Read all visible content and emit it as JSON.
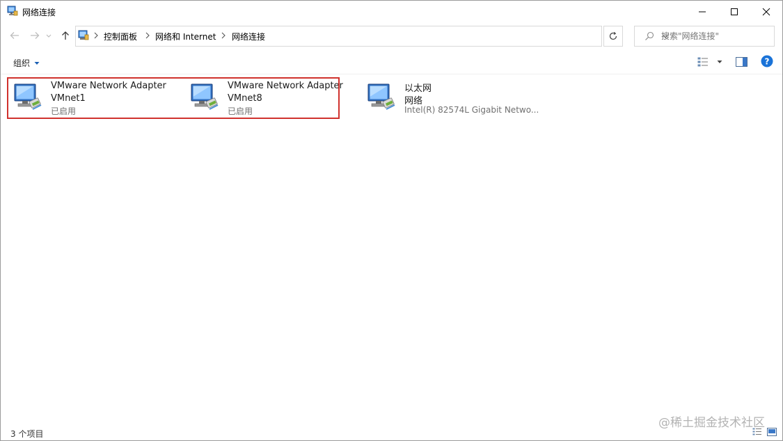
{
  "window": {
    "title": "网络连接",
    "app_icon": "network-connections-icon",
    "controls": [
      "minimize-icon",
      "maximize-icon",
      "close-icon"
    ]
  },
  "address_bar": {
    "location_icon": "control-panel-icon",
    "breadcrumbs": [
      "控制面板",
      "网络和 Internet",
      "网络连接"
    ],
    "search_placeholder": "搜索\"网络连接\""
  },
  "toolbar": {
    "organize_label": "组织",
    "view_options_icon": "change-view-icon",
    "preview_pane_icon": "preview-pane-icon",
    "help_icon": "help-icon"
  },
  "items": [
    {
      "name": "VMware Network Adapter",
      "sub": "VMnet1",
      "status": "已启用",
      "icon": "network-adapter-icon"
    },
    {
      "name": "VMware Network Adapter",
      "sub": "VMnet8",
      "status": "已启用",
      "icon": "network-adapter-icon"
    },
    {
      "name": "以太网",
      "sub": "网络",
      "status": "Intel(R) 82574L Gigabit Netwo...",
      "icon": "network-adapter-icon"
    }
  ],
  "statusbar": {
    "count": "3 个项目",
    "watermark": "@稀土掘金技术社区"
  },
  "colors": {
    "highlight_border": "#d0312d",
    "accent_blue": "#1a6fd8",
    "help_blue": "#1a73d8"
  }
}
